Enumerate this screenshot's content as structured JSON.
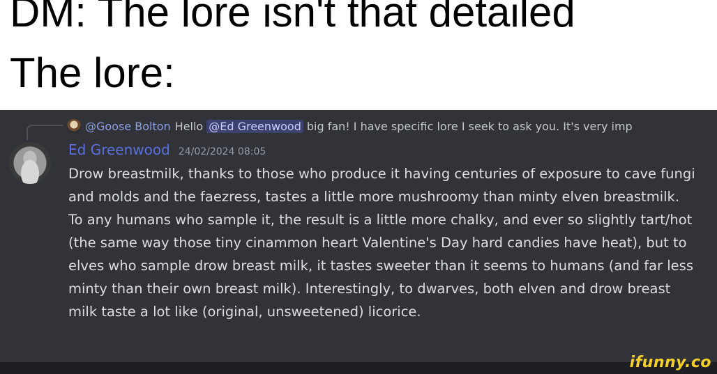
{
  "caption": {
    "line1": "DM: The lore isn't that detailed",
    "line2": "The lore:"
  },
  "reply": {
    "author": "@Goose Bolton",
    "text_before": "Hello",
    "mention": "@Ed Greenwood",
    "text_after": "big fan! I have specific lore I seek to ask you. It's very imp"
  },
  "message": {
    "author": "Ed Greenwood",
    "timestamp": "24/02/2024 08:05",
    "body": "Drow breastmilk, thanks to those who produce it having centuries of exposure to cave fungi and molds and the faezress, tastes a little more mushroomy than minty elven breastmilk. To any humans who sample it, the result is a little more chalky, and ever so slightly tart/hot (the same way those tiny cinammon heart Valentine's Day hard candies have heat), but to elves who sample drow breast milk, it tastes sweeter than it seems to humans (and far less minty than their own breast milk). Interestingly, to dwarves, both elven and drow breast milk taste a lot like (original, unsweetened) licorice."
  },
  "watermark": "ifunny.co",
  "colors": {
    "discord_bg": "#313338",
    "author_name": "#5c6fde",
    "message_text": "#dbdee1",
    "watermark": "#f5cf2a"
  }
}
